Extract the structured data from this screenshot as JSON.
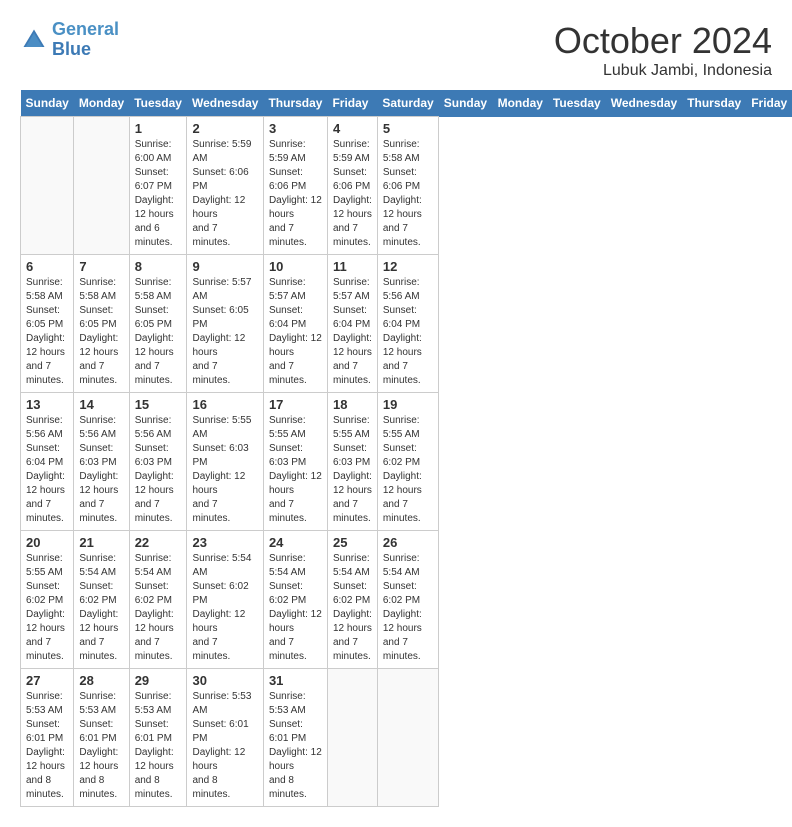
{
  "header": {
    "logo_line1": "General",
    "logo_line2": "Blue",
    "month": "October 2024",
    "location": "Lubuk Jambi, Indonesia"
  },
  "days_of_week": [
    "Sunday",
    "Monday",
    "Tuesday",
    "Wednesday",
    "Thursday",
    "Friday",
    "Saturday"
  ],
  "weeks": [
    [
      {
        "day": "",
        "info": ""
      },
      {
        "day": "",
        "info": ""
      },
      {
        "day": "1",
        "info": "Sunrise: 6:00 AM\nSunset: 6:07 PM\nDaylight: 12 hours\nand 6 minutes."
      },
      {
        "day": "2",
        "info": "Sunrise: 5:59 AM\nSunset: 6:06 PM\nDaylight: 12 hours\nand 7 minutes."
      },
      {
        "day": "3",
        "info": "Sunrise: 5:59 AM\nSunset: 6:06 PM\nDaylight: 12 hours\nand 7 minutes."
      },
      {
        "day": "4",
        "info": "Sunrise: 5:59 AM\nSunset: 6:06 PM\nDaylight: 12 hours\nand 7 minutes."
      },
      {
        "day": "5",
        "info": "Sunrise: 5:58 AM\nSunset: 6:06 PM\nDaylight: 12 hours\nand 7 minutes."
      }
    ],
    [
      {
        "day": "6",
        "info": "Sunrise: 5:58 AM\nSunset: 6:05 PM\nDaylight: 12 hours\nand 7 minutes."
      },
      {
        "day": "7",
        "info": "Sunrise: 5:58 AM\nSunset: 6:05 PM\nDaylight: 12 hours\nand 7 minutes."
      },
      {
        "day": "8",
        "info": "Sunrise: 5:58 AM\nSunset: 6:05 PM\nDaylight: 12 hours\nand 7 minutes."
      },
      {
        "day": "9",
        "info": "Sunrise: 5:57 AM\nSunset: 6:05 PM\nDaylight: 12 hours\nand 7 minutes."
      },
      {
        "day": "10",
        "info": "Sunrise: 5:57 AM\nSunset: 6:04 PM\nDaylight: 12 hours\nand 7 minutes."
      },
      {
        "day": "11",
        "info": "Sunrise: 5:57 AM\nSunset: 6:04 PM\nDaylight: 12 hours\nand 7 minutes."
      },
      {
        "day": "12",
        "info": "Sunrise: 5:56 AM\nSunset: 6:04 PM\nDaylight: 12 hours\nand 7 minutes."
      }
    ],
    [
      {
        "day": "13",
        "info": "Sunrise: 5:56 AM\nSunset: 6:04 PM\nDaylight: 12 hours\nand 7 minutes."
      },
      {
        "day": "14",
        "info": "Sunrise: 5:56 AM\nSunset: 6:03 PM\nDaylight: 12 hours\nand 7 minutes."
      },
      {
        "day": "15",
        "info": "Sunrise: 5:56 AM\nSunset: 6:03 PM\nDaylight: 12 hours\nand 7 minutes."
      },
      {
        "day": "16",
        "info": "Sunrise: 5:55 AM\nSunset: 6:03 PM\nDaylight: 12 hours\nand 7 minutes."
      },
      {
        "day": "17",
        "info": "Sunrise: 5:55 AM\nSunset: 6:03 PM\nDaylight: 12 hours\nand 7 minutes."
      },
      {
        "day": "18",
        "info": "Sunrise: 5:55 AM\nSunset: 6:03 PM\nDaylight: 12 hours\nand 7 minutes."
      },
      {
        "day": "19",
        "info": "Sunrise: 5:55 AM\nSunset: 6:02 PM\nDaylight: 12 hours\nand 7 minutes."
      }
    ],
    [
      {
        "day": "20",
        "info": "Sunrise: 5:55 AM\nSunset: 6:02 PM\nDaylight: 12 hours\nand 7 minutes."
      },
      {
        "day": "21",
        "info": "Sunrise: 5:54 AM\nSunset: 6:02 PM\nDaylight: 12 hours\nand 7 minutes."
      },
      {
        "day": "22",
        "info": "Sunrise: 5:54 AM\nSunset: 6:02 PM\nDaylight: 12 hours\nand 7 minutes."
      },
      {
        "day": "23",
        "info": "Sunrise: 5:54 AM\nSunset: 6:02 PM\nDaylight: 12 hours\nand 7 minutes."
      },
      {
        "day": "24",
        "info": "Sunrise: 5:54 AM\nSunset: 6:02 PM\nDaylight: 12 hours\nand 7 minutes."
      },
      {
        "day": "25",
        "info": "Sunrise: 5:54 AM\nSunset: 6:02 PM\nDaylight: 12 hours\nand 7 minutes."
      },
      {
        "day": "26",
        "info": "Sunrise: 5:54 AM\nSunset: 6:02 PM\nDaylight: 12 hours\nand 7 minutes."
      }
    ],
    [
      {
        "day": "27",
        "info": "Sunrise: 5:53 AM\nSunset: 6:01 PM\nDaylight: 12 hours\nand 8 minutes."
      },
      {
        "day": "28",
        "info": "Sunrise: 5:53 AM\nSunset: 6:01 PM\nDaylight: 12 hours\nand 8 minutes."
      },
      {
        "day": "29",
        "info": "Sunrise: 5:53 AM\nSunset: 6:01 PM\nDaylight: 12 hours\nand 8 minutes."
      },
      {
        "day": "30",
        "info": "Sunrise: 5:53 AM\nSunset: 6:01 PM\nDaylight: 12 hours\nand 8 minutes."
      },
      {
        "day": "31",
        "info": "Sunrise: 5:53 AM\nSunset: 6:01 PM\nDaylight: 12 hours\nand 8 minutes."
      },
      {
        "day": "",
        "info": ""
      },
      {
        "day": "",
        "info": ""
      }
    ]
  ]
}
